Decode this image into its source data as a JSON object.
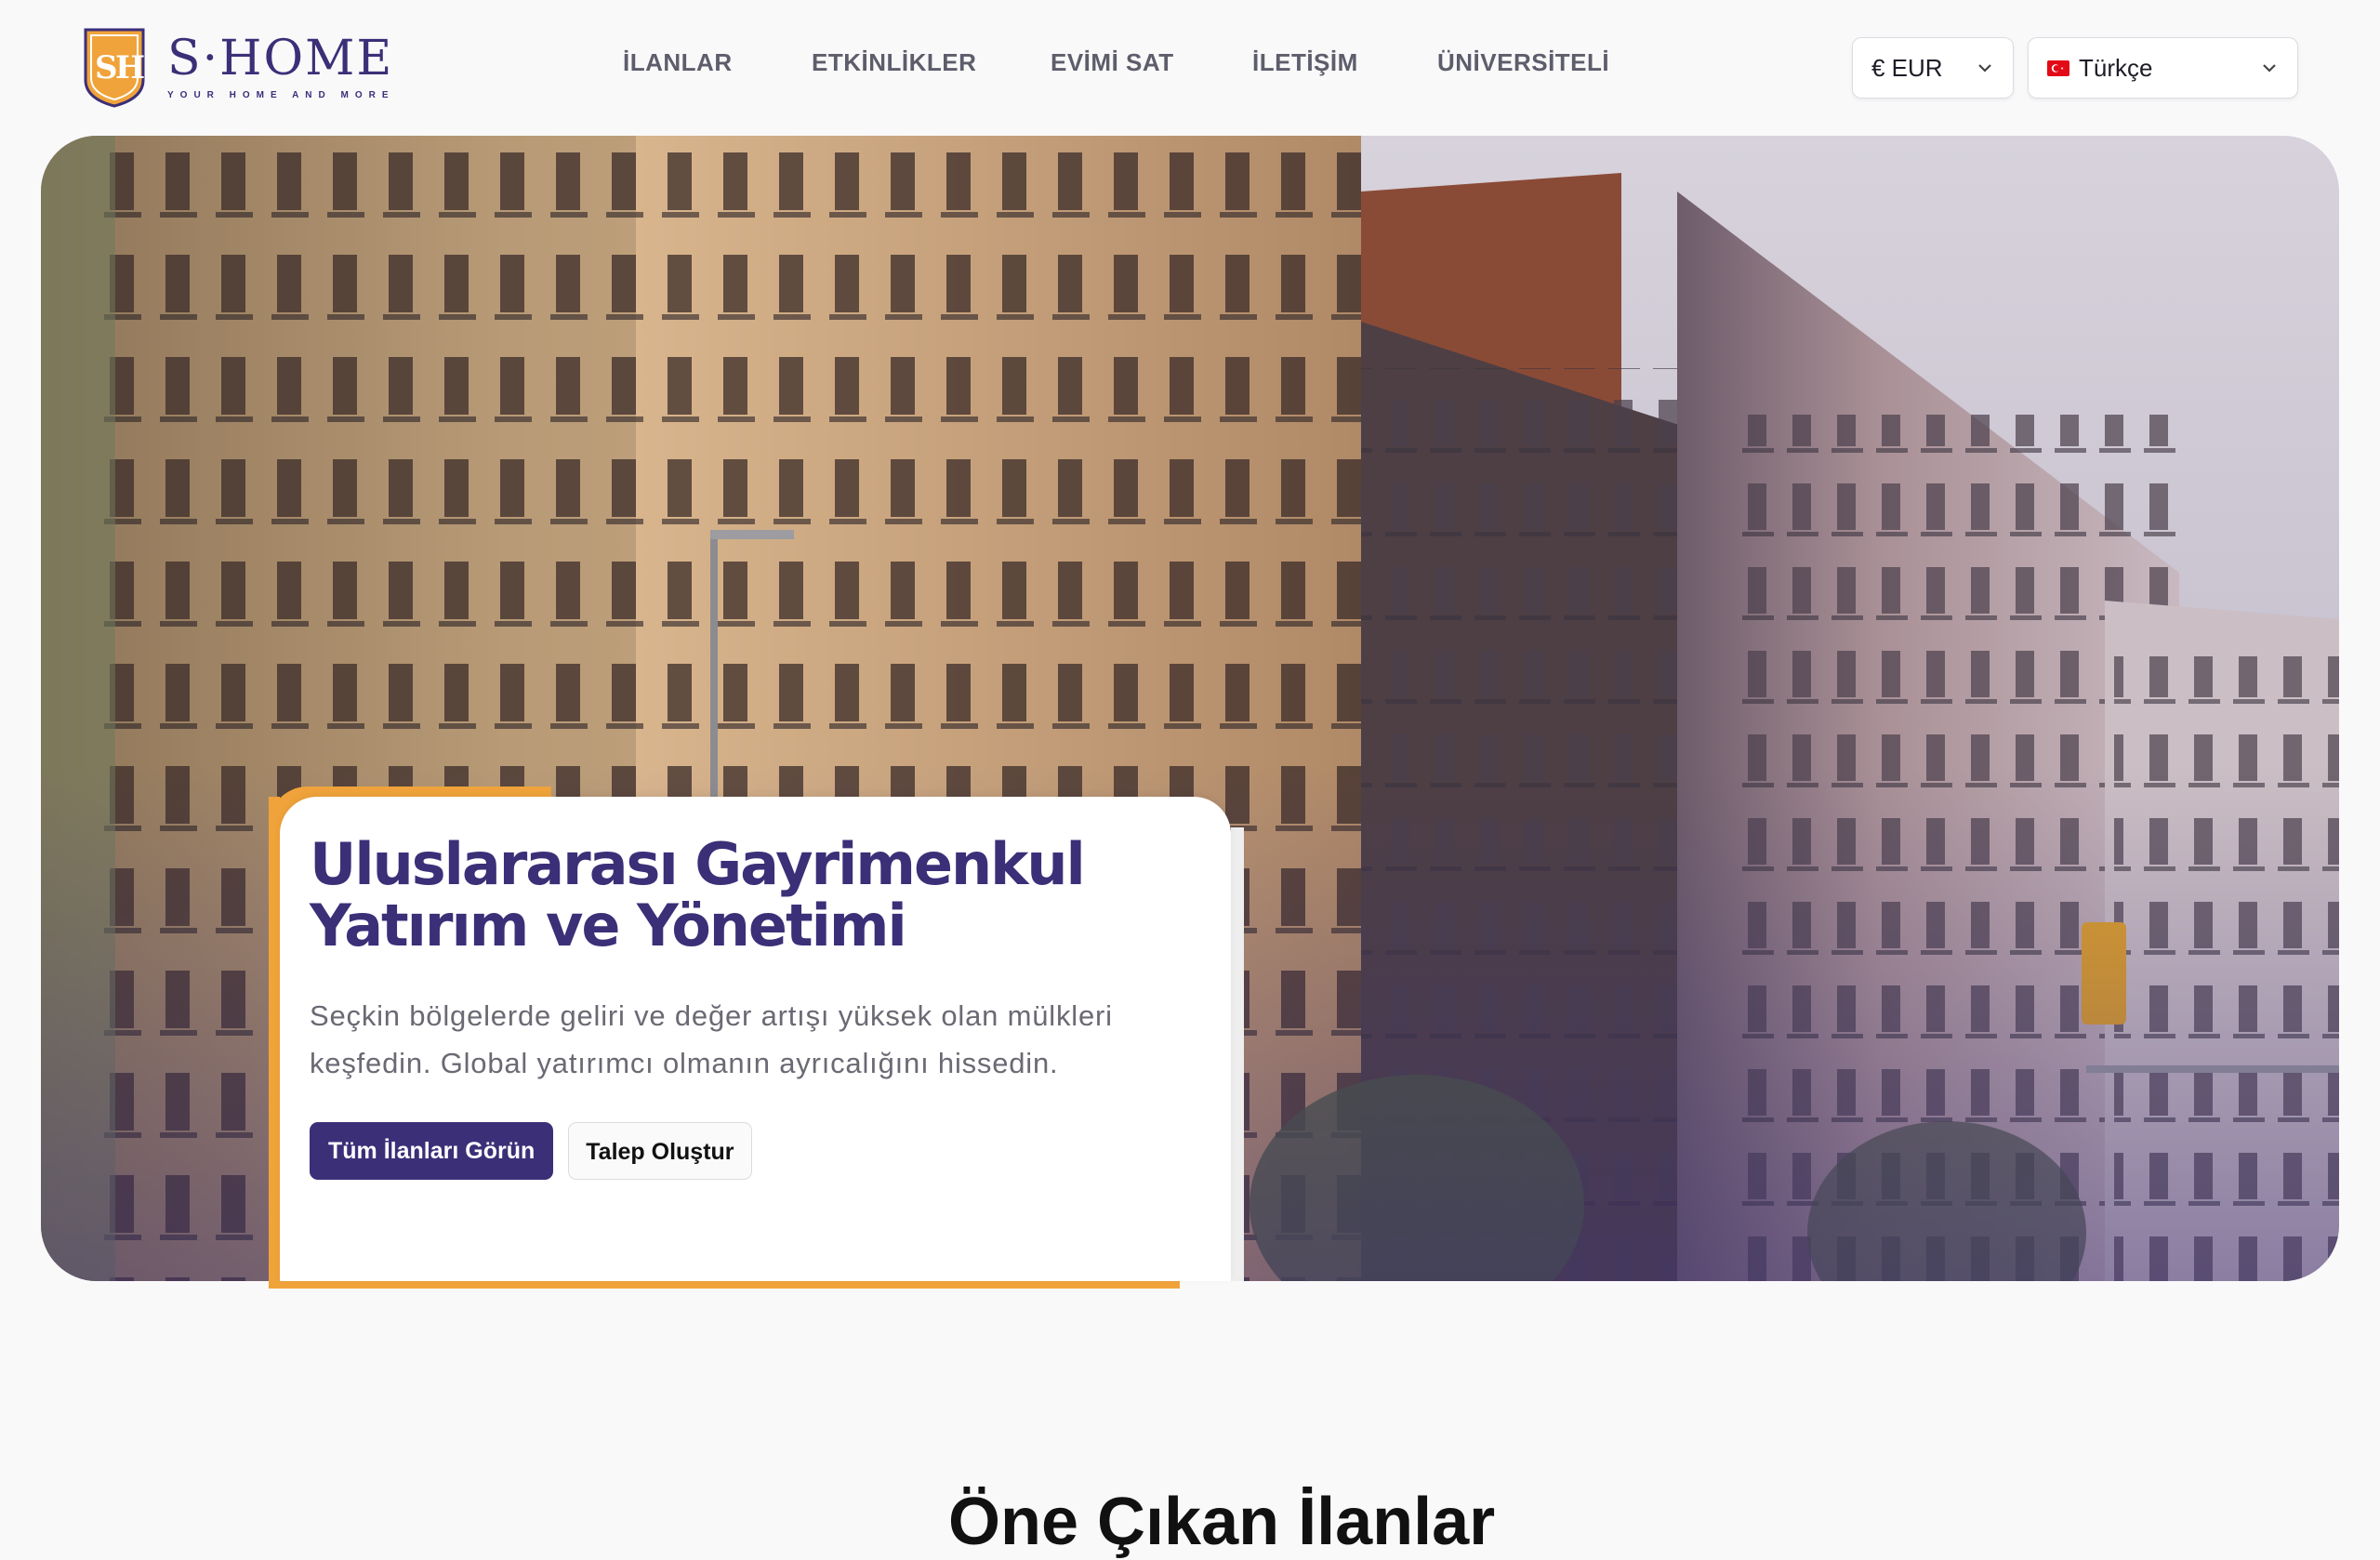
{
  "brand": {
    "name": "S·HOME",
    "tagline": "YOUR HOME AND MORE",
    "primary_color": "#3b2f78",
    "accent_color": "#f0a33a"
  },
  "nav": {
    "items": [
      {
        "label": "İLANLAR"
      },
      {
        "label": "ETKİNLİKLER"
      },
      {
        "label": "EVİMİ SAT"
      },
      {
        "label": "İLETİŞİM"
      },
      {
        "label": "ÜNİVERSİTELİ"
      }
    ]
  },
  "currency_select": {
    "value": "€ EUR",
    "icon": "chevron-down-icon"
  },
  "language_select": {
    "value": "Türkçe",
    "flag": "turkey-flag-icon",
    "icon": "chevron-down-icon"
  },
  "hero": {
    "title": "Uluslararası Gayrimenkul Yatırım ve Yönetimi",
    "description": "Seçkin bölgelerde geliri ve değer artışı yüksek olan mülkleri keşfedin. Global yatırımcı olmanın ayrıcalığını hissedin.",
    "primary_button": "Tüm İlanları Görün",
    "secondary_button": "Talep Oluştur"
  },
  "next_section": {
    "title": "Öne Çıkan İlanlar"
  }
}
